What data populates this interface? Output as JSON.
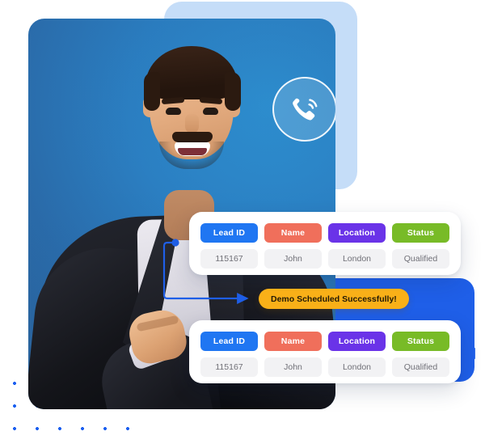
{
  "illustration": {
    "alt_label": "Sales agent celebrating with lead data cards",
    "phone_icon": "phone-call-icon"
  },
  "colors": {
    "lead_id": "#1f76f2",
    "name": "#f06f5b",
    "location": "#6a33e8",
    "status": "#78bb27",
    "pill": "#f9b018",
    "arrow": "#1f5fe8",
    "card_light_blue": "#c5ddf8",
    "card_blue": "#1f5fe8"
  },
  "cards": [
    {
      "id": "lead-card-top",
      "headers": [
        "Lead ID",
        "Name",
        "Location",
        "Status"
      ],
      "values": [
        "115167",
        "John",
        "London",
        "Qualified"
      ]
    },
    {
      "id": "lead-card-bottom",
      "headers": [
        "Lead ID",
        "Name",
        "Location",
        "Status"
      ],
      "values": [
        "115167",
        "John",
        "London",
        "Qualified"
      ]
    }
  ],
  "notification": {
    "label": "Demo Scheduled Successfully!"
  }
}
